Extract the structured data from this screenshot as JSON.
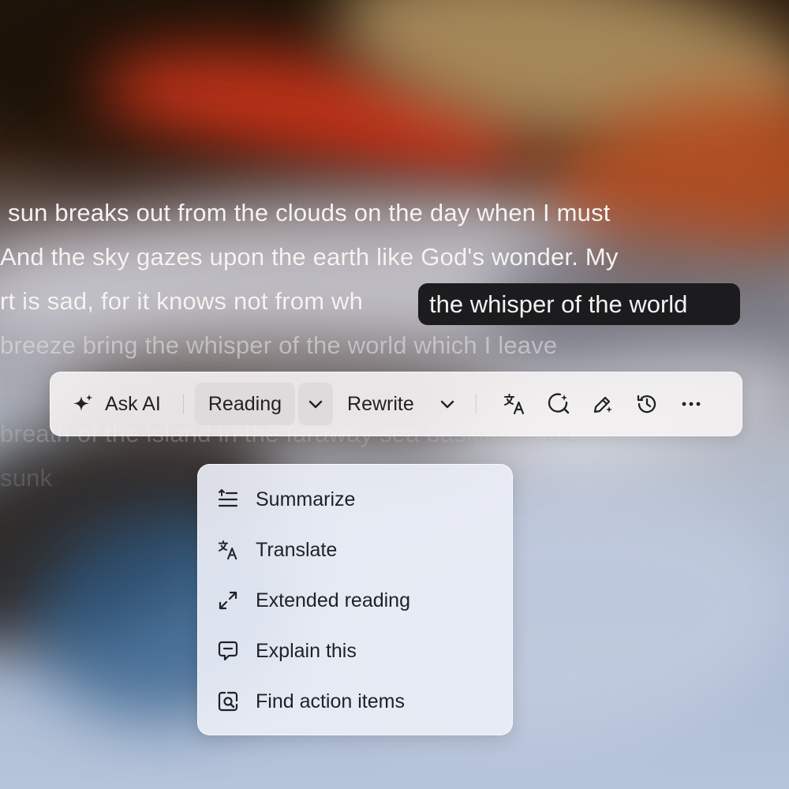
{
  "passage": {
    "lines": [
      " sun breaks out from the clouds on the day when I must",
      "And the sky gazes upon the earth like God's wonder. My",
      "rt is sad, for it knows not from wh",
      "breeze bring the whisper of the world which I leave",
      "breath of the island in the faraway sea basking in the",
      "     sunk"
    ],
    "selected_text": "the whisper of the world"
  },
  "toolbar": {
    "ask_ai_label": "Ask AI",
    "reading_label": "Reading",
    "rewrite_label": "Rewrite",
    "icons": [
      "sparkle-icon",
      "chevron-down-icon",
      "translate-icon",
      "search-ai-icon",
      "pen-icon",
      "history-icon",
      "more-icon"
    ]
  },
  "menu": {
    "items": [
      {
        "label": "Summarize",
        "icon": "summarize-icon"
      },
      {
        "label": "Translate",
        "icon": "translate-icon"
      },
      {
        "label": "Extended reading",
        "icon": "expand-icon"
      },
      {
        "label": "Explain this",
        "icon": "chat-icon"
      },
      {
        "label": "Find action items",
        "icon": "find-icon"
      }
    ]
  },
  "colors": {
    "selection_bg": "#1c1c1e",
    "toolbar_bg": "#f6f3f4",
    "menu_bg": "#eaeef6",
    "text": "#202226"
  }
}
